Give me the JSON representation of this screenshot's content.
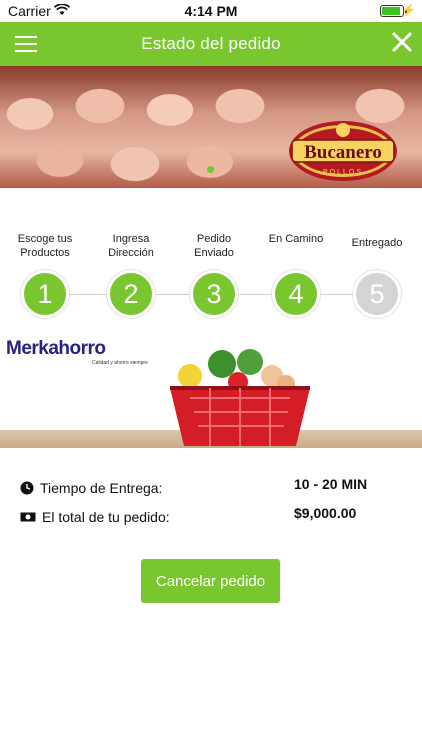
{
  "status_bar": {
    "carrier": "Carrier",
    "time": "4:14 PM"
  },
  "navbar": {
    "title": "Estado del pedido",
    "menu_icon": "hamburger-menu-icon",
    "close_icon": "close-icon"
  },
  "banner": {
    "logo_text": "Bucanero",
    "logo_subtext": "POLLOS"
  },
  "steps": [
    {
      "label": "Escoge tus\nProductos",
      "number": "1"
    },
    {
      "label": "Ingresa\nDirección",
      "number": "2"
    },
    {
      "label": "Pedido\nEnviado",
      "number": "3"
    },
    {
      "label": "En Camino",
      "number": "4"
    },
    {
      "label": "Entregado",
      "number": "5"
    }
  ],
  "store_banner": {
    "brand": "Merkahorro",
    "tagline": "Calidad y ahorro siempre"
  },
  "order": {
    "delivery_label": "Tiempo de Entrega:",
    "delivery_value": "10 - 20 MIN",
    "total_label": "El total de tu pedido:",
    "total_value": "$9,000.00"
  },
  "cancel_label": "Cancelar pedido",
  "colors": {
    "accent": "#79c62f",
    "inactive_step": "#d4d4d4"
  }
}
